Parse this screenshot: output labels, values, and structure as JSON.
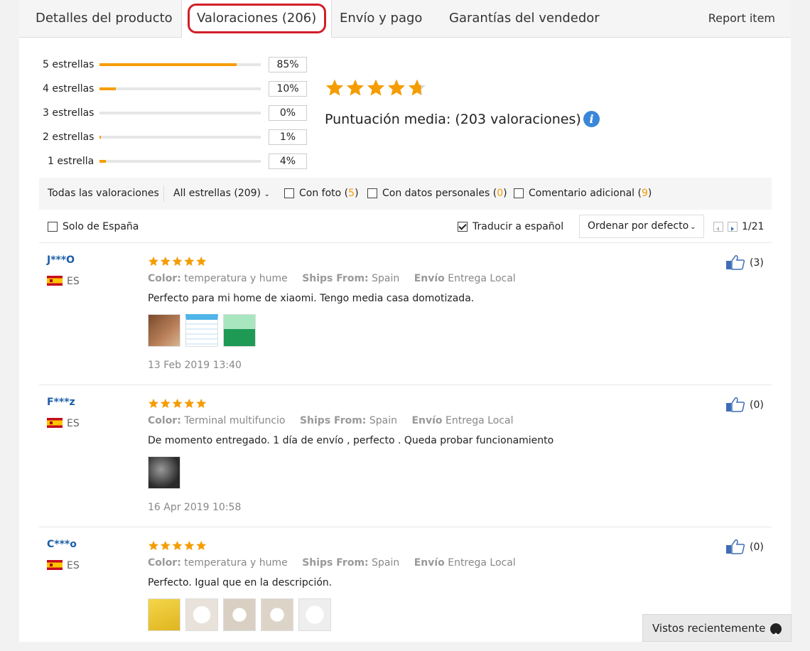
{
  "tabs": {
    "items": [
      {
        "label": "Detalles del producto"
      },
      {
        "label": "Valoraciones (206)"
      },
      {
        "label": "Envío y pago"
      },
      {
        "label": "Garantías del vendedor"
      }
    ],
    "active_index": 1,
    "report_label": "Report item"
  },
  "ratings": {
    "histogram": [
      {
        "label": "5 estrellas",
        "percent": "85%",
        "fraction": 0.85
      },
      {
        "label": "4 estrellas",
        "percent": "10%",
        "fraction": 0.1
      },
      {
        "label": "3 estrellas",
        "percent": "0%",
        "fraction": 0.0
      },
      {
        "label": "2 estrellas",
        "percent": "1%",
        "fraction": 0.01
      },
      {
        "label": "1 estrella",
        "percent": "4%",
        "fraction": 0.04
      }
    ],
    "average_stars": 4.7,
    "average_label": "Puntuación media:  (203 valoraciones)"
  },
  "filters": {
    "all_label": "Todas las valoraciones",
    "stars_select": "All estrellas (209)",
    "with_photo": {
      "label": "Con foto",
      "count": "5"
    },
    "personal_data": {
      "label": "Con datos personales",
      "count": "0"
    },
    "additional": {
      "label": "Comentario adicional",
      "count": "9"
    },
    "only_spain": "Solo de España",
    "translate": "Traducir a español",
    "sort": "Ordenar por defecto",
    "page": "1/21"
  },
  "attr_labels": {
    "color": "Color:",
    "ships": "Ships From:",
    "envio": "Envío"
  },
  "reviews": [
    {
      "user": "J***O",
      "country": "ES",
      "stars": 5,
      "color": "temperatura y hume",
      "ships_from": "Spain",
      "envio": "Entrega Local",
      "text": "Perfecto para mi home de xiaomi. Tengo media casa domotizada.",
      "date": "13 Feb 2019 13:40",
      "likes": "(3)"
    },
    {
      "user": "F***z",
      "country": "ES",
      "stars": 5,
      "color": "Terminal multifuncio",
      "ships_from": "Spain",
      "envio": "Entrega Local",
      "text": "De momento entregado. 1 día de envío , perfecto . Queda probar funcionamiento",
      "date": "16 Apr 2019 10:58",
      "likes": "(0)"
    },
    {
      "user": "C***o",
      "country": "ES",
      "stars": 5,
      "color": "temperatura y hume",
      "ships_from": "Spain",
      "envio": "Entrega Local",
      "text": "Perfecto. Igual que en la descripción.",
      "date": "",
      "likes": "(0)"
    }
  ],
  "recent": "Vistos recientemente",
  "colors": {
    "star": "#f59d00",
    "bar": "#f59d00",
    "link": "#1b5ea8",
    "highlight": "#d21f2a"
  }
}
